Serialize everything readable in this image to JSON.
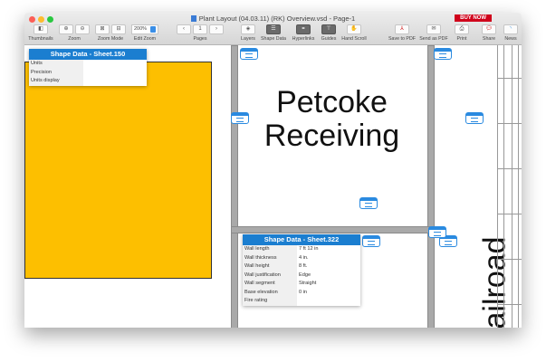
{
  "window": {
    "title": "Plant Layout (04.03.11) (RK) Overview.vsd - Page-1",
    "buy_now": "BUY NOW"
  },
  "toolbar": {
    "thumbnails": "Thumbnails",
    "zoom": "Zoom",
    "zoom_mode": "Zoom Mode",
    "edit_zoom": "Edit Zoom",
    "zoom_value": "200%",
    "pages": "Pages",
    "page_number": "1",
    "layers": "Layers",
    "shape_data": "Shape Data",
    "hyperlinks": "Hyperlinks",
    "guides": "Guides",
    "hand_scroll": "Hand Scroll",
    "save_pdf": "Save to PDF",
    "send_pdf": "Send as PDF",
    "print": "Print",
    "share": "Share",
    "news": "News"
  },
  "canvas": {
    "label_main": "Petcoke Receiving",
    "label_rail": "ailroad",
    "colors": {
      "fill": "#fdbf00",
      "header": "#1b7ed0"
    }
  },
  "shape_data_1": {
    "title": "Shape Data - Sheet.150",
    "rows": [
      {
        "k": "Units",
        "v": ""
      },
      {
        "k": "Precision",
        "v": ""
      },
      {
        "k": "Units display",
        "v": ""
      }
    ]
  },
  "shape_data_2": {
    "title": "Shape Data - Sheet.322",
    "rows": [
      {
        "k": "Wall length",
        "v": "7 ft 12 in"
      },
      {
        "k": "Wall thickness",
        "v": "4 in."
      },
      {
        "k": "Wall height",
        "v": "8 ft."
      },
      {
        "k": "Wall justification",
        "v": "Edge"
      },
      {
        "k": "Wall segment",
        "v": "Straight"
      },
      {
        "k": "Base elevation",
        "v": "0 in"
      },
      {
        "k": "Fire rating",
        "v": ""
      }
    ]
  }
}
